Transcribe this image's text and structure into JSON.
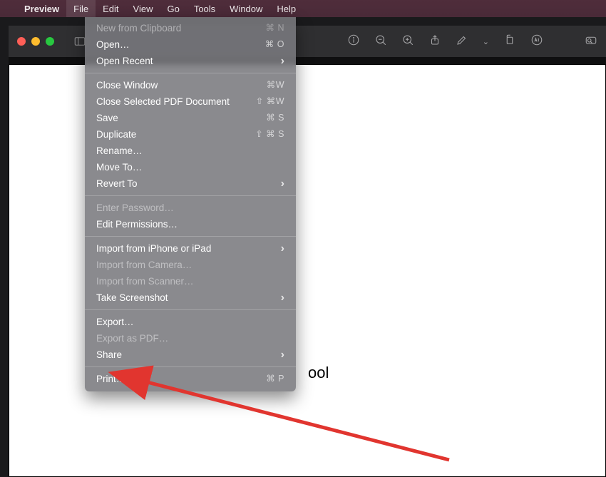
{
  "menubar": {
    "app_name": "Preview",
    "items": [
      "File",
      "Edit",
      "View",
      "Go",
      "Tools",
      "Window",
      "Help"
    ],
    "active_index": 0
  },
  "dropdown": {
    "groups": [
      [
        {
          "label": "New from Clipboard",
          "shortcut": "⌘ N",
          "disabled": true
        },
        {
          "label": "Open…",
          "shortcut": "⌘ O"
        },
        {
          "label": "Open Recent",
          "submenu": true
        }
      ],
      [
        {
          "label": "Close Window",
          "shortcut": "⌘W"
        },
        {
          "label": "Close Selected PDF Document",
          "shortcut": "⇧ ⌘W"
        },
        {
          "label": "Save",
          "shortcut": "⌘ S"
        },
        {
          "label": "Duplicate",
          "shortcut": "⇧ ⌘ S"
        },
        {
          "label": "Rename…"
        },
        {
          "label": "Move To…"
        },
        {
          "label": "Revert To",
          "submenu": true
        }
      ],
      [
        {
          "label": "Enter Password…",
          "disabled": true
        },
        {
          "label": "Edit Permissions…"
        }
      ],
      [
        {
          "label": "Import from iPhone or iPad",
          "submenu": true
        },
        {
          "label": "Import from Camera…",
          "disabled": true
        },
        {
          "label": "Import from Scanner…",
          "disabled": true
        },
        {
          "label": "Take Screenshot",
          "submenu": true
        }
      ],
      [
        {
          "label": "Export…"
        },
        {
          "label": "Export as PDF…",
          "disabled": true
        },
        {
          "label": "Share",
          "submenu": true
        }
      ],
      [
        {
          "label": "Print…",
          "shortcut": "⌘ P"
        }
      ]
    ]
  },
  "document": {
    "visible_text_fragment": "ool"
  },
  "toolbar_icons": [
    "sidebar",
    "spacer",
    "info",
    "zoom-out",
    "zoom-in",
    "share",
    "pencil",
    "chevron-down",
    "rotate",
    "markup",
    "spacer2",
    "search"
  ]
}
